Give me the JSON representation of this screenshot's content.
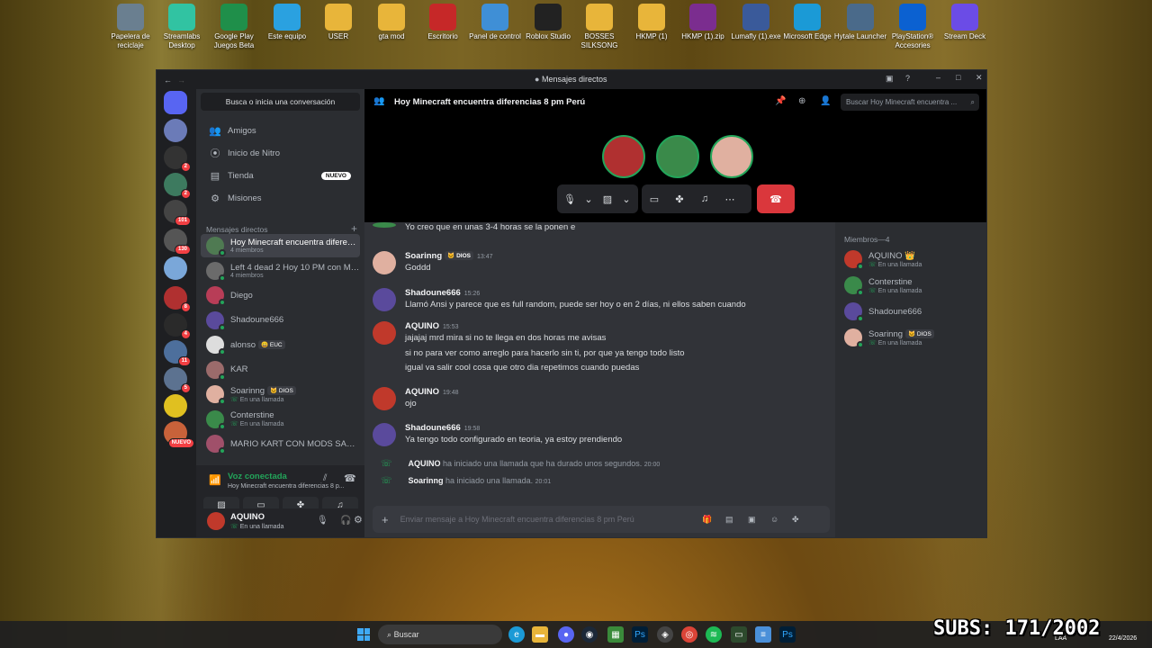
{
  "desktop_icons": [
    {
      "label": "Papelera de reciclaje",
      "icon": "recycle-bin-icon",
      "color": "#6a7f90"
    },
    {
      "label": "Streamlabs Desktop",
      "icon": "streamlabs-icon",
      "color": "#31c3a2"
    },
    {
      "label": "Google Play Juegos Beta",
      "icon": "google-play-games-icon",
      "color": "#1f8f4a"
    },
    {
      "label": "Este equipo",
      "icon": "computer-icon",
      "color": "#2aa1e0"
    },
    {
      "label": "USER",
      "icon": "user-folder-icon",
      "color": "#e8b53a"
    },
    {
      "label": "gta mod",
      "icon": "folder-icon",
      "color": "#e8b53a"
    },
    {
      "label": "Escritorio",
      "icon": "desktop-folder-icon",
      "color": "#c62828"
    },
    {
      "label": "Panel de control",
      "icon": "control-panel-icon",
      "color": "#3f8fd6"
    },
    {
      "label": "Roblox Studio",
      "icon": "roblox-icon",
      "color": "#222222"
    },
    {
      "label": "BOSSES SILKSONG",
      "icon": "folder-icon",
      "color": "#e8b53a"
    },
    {
      "label": "HKMP (1)",
      "icon": "folder-icon",
      "color": "#e8b53a"
    },
    {
      "label": "HKMP (1).zip",
      "icon": "winrar-icon",
      "color": "#7b2d8f"
    },
    {
      "label": "Lumafly (1).exe",
      "icon": "lumafly-icon",
      "color": "#3a5a9a"
    },
    {
      "label": "Microsoft Edge",
      "icon": "edge-icon",
      "color": "#1b9ad6"
    },
    {
      "label": "Hytale Launcher",
      "icon": "hytale-icon",
      "color": "#4a6a8a"
    },
    {
      "label": "PlayStation® Accesories",
      "icon": "playstation-icon",
      "color": "#0b61d1"
    },
    {
      "label": "Stream Deck",
      "icon": "stream-deck-icon",
      "color": "#6b4ce6"
    }
  ],
  "window": {
    "title": "Mensajes directos"
  },
  "guilds": [
    {
      "badge": "",
      "color": "#5865f2"
    },
    {
      "badge": "",
      "color": "#6b7bb8"
    },
    {
      "badge": "2",
      "color": "#333"
    },
    {
      "badge": "2",
      "color": "#3d7a5f"
    },
    {
      "badge": "101",
      "color": "#444"
    },
    {
      "badge": "130",
      "color": "#555"
    },
    {
      "badge": "",
      "color": "#7aa7d9"
    },
    {
      "badge": "8",
      "color": "#b03030"
    },
    {
      "badge": "4",
      "color": "#2a2a2a"
    },
    {
      "badge": "11",
      "color": "#4d6f9c"
    },
    {
      "badge": "5",
      "color": "#5c7290"
    },
    {
      "badge": "",
      "color": "#e0c020"
    },
    {
      "badge": "NUEVO",
      "color": "#c8623a"
    }
  ],
  "sidebar": {
    "search": "Busca o inicia una conversación",
    "nav": [
      {
        "label": "Amigos",
        "icon": "friends-icon"
      },
      {
        "label": "Inicio de Nitro",
        "icon": "nitro-icon"
      },
      {
        "label": "Tienda",
        "icon": "shop-icon",
        "badge": "NUEVO"
      },
      {
        "label": "Misiones",
        "icon": "quests-icon"
      }
    ],
    "dm_header": "Mensajes directos",
    "dm_add": "+",
    "dms": [
      {
        "name": "Hoy Minecraft encuentra diferencias 8 pm Perú",
        "sub": "4 miembros",
        "color": "#4f7a52",
        "active": true
      },
      {
        "name": "Left 4 dead 2 Hoy 10 PM con Miembros",
        "sub": "4 miembros",
        "color": "#6b6b6b"
      },
      {
        "name": "Diego",
        "sub": "",
        "color": "#b83d57",
        "tag": ""
      },
      {
        "name": "Shadoune666",
        "sub": "",
        "color": "#5a4a9c",
        "tag": ""
      },
      {
        "name": "alonso",
        "sub": "",
        "color": "#ddd",
        "tag": "😀 EUC"
      },
      {
        "name": "KAR",
        "sub": "",
        "color": "#9b6b6b",
        "tag": ""
      },
      {
        "name": "Soarinng",
        "sub": "En una llamada",
        "color": "#e0b0a0",
        "tag": "🐱 DIOS"
      },
      {
        "name": "Conterstine",
        "sub": "En una llamada",
        "color": "#3a8a4a",
        "tag": ""
      },
      {
        "name": "MARIO KART CON MODS SABADO",
        "sub": "",
        "color": "#a0506a",
        "tag": ""
      }
    ],
    "voice": {
      "status": "Voz conectada",
      "channel": "Hoy Minecraft encuentra diferencias 8 p..."
    },
    "user": {
      "name": "AQUINO",
      "status": "En una llamada"
    }
  },
  "header": {
    "title": "Hoy Minecraft encuentra diferencias 8 pm Perú",
    "search_placeholder": "Buscar Hoy Minecraft encuentra ..."
  },
  "messages": [
    {
      "author": "",
      "time": "",
      "tag": "",
      "lines": [
        "Yo creo que en unas 3-4 horas se la ponen e"
      ],
      "color": "#3a8a4a"
    },
    {
      "author": "Soarinng",
      "time": "13:47",
      "tag": "🐱 DIOS",
      "lines": [
        "Goddd"
      ],
      "color": "#e0b0a0"
    },
    {
      "author": "Shadoune666",
      "time": "15:26",
      "tag": "",
      "lines": [
        "Llamó Ansi y parece que es full random, puede ser hoy o en 2 días, ni ellos saben cuando"
      ],
      "color": "#5a4a9c"
    },
    {
      "author": "AQUINO",
      "time": "15:53",
      "tag": "",
      "lines": [
        "jajajaj mrd mira si no te llega en dos horas me avisas",
        "si no para ver como arreglo para hacerlo sin ti, por que ya tengo todo listo",
        "igual va salir cool cosa que otro dia repetimos cuando puedas"
      ],
      "color": "#c0392b"
    },
    {
      "author": "AQUINO",
      "time": "19:48",
      "tag": "",
      "lines": [
        "ojo"
      ],
      "color": "#c0392b"
    },
    {
      "author": "Shadoune666",
      "time": "19:58",
      "tag": "",
      "lines": [
        "Ya tengo todo configurado en teoria, ya estoy prendiendo"
      ],
      "color": "#5a4a9c"
    }
  ],
  "system_messages": [
    {
      "author": "AQUINO",
      "text": "ha iniciado una llamada que ha durado unos segundos.",
      "time": "20:00"
    },
    {
      "author": "Soarinng",
      "text": "ha iniciado una llamada.",
      "time": "20:01"
    }
  ],
  "composer": {
    "placeholder": "Enviar mensaje a Hoy Minecraft encuentra diferencias 8 pm Perú"
  },
  "members": {
    "header": "Miembros—4",
    "list": [
      {
        "name": "AQUINO",
        "crown": "👑",
        "status": "En una llamada",
        "tag": "",
        "color": "#c0392b"
      },
      {
        "name": "Conterstine",
        "crown": "",
        "status": "En una llamada",
        "tag": "",
        "color": "#3a8a4a"
      },
      {
        "name": "Shadoune666",
        "crown": "",
        "status": "",
        "tag": "",
        "color": "#5a4a9c"
      },
      {
        "name": "Soarinng",
        "crown": "",
        "status": "En una llamada",
        "tag": "🐱 DIOS",
        "color": "#e0b0a0"
      }
    ]
  },
  "taskbar": {
    "search": "Buscar",
    "lang": "LAA",
    "date": "22/4/2026"
  },
  "overlay": {
    "subs": "SUBS: 171/2002"
  },
  "colors": {
    "accent": "#5865f2",
    "online": "#23a55a",
    "danger": "#da373c"
  }
}
